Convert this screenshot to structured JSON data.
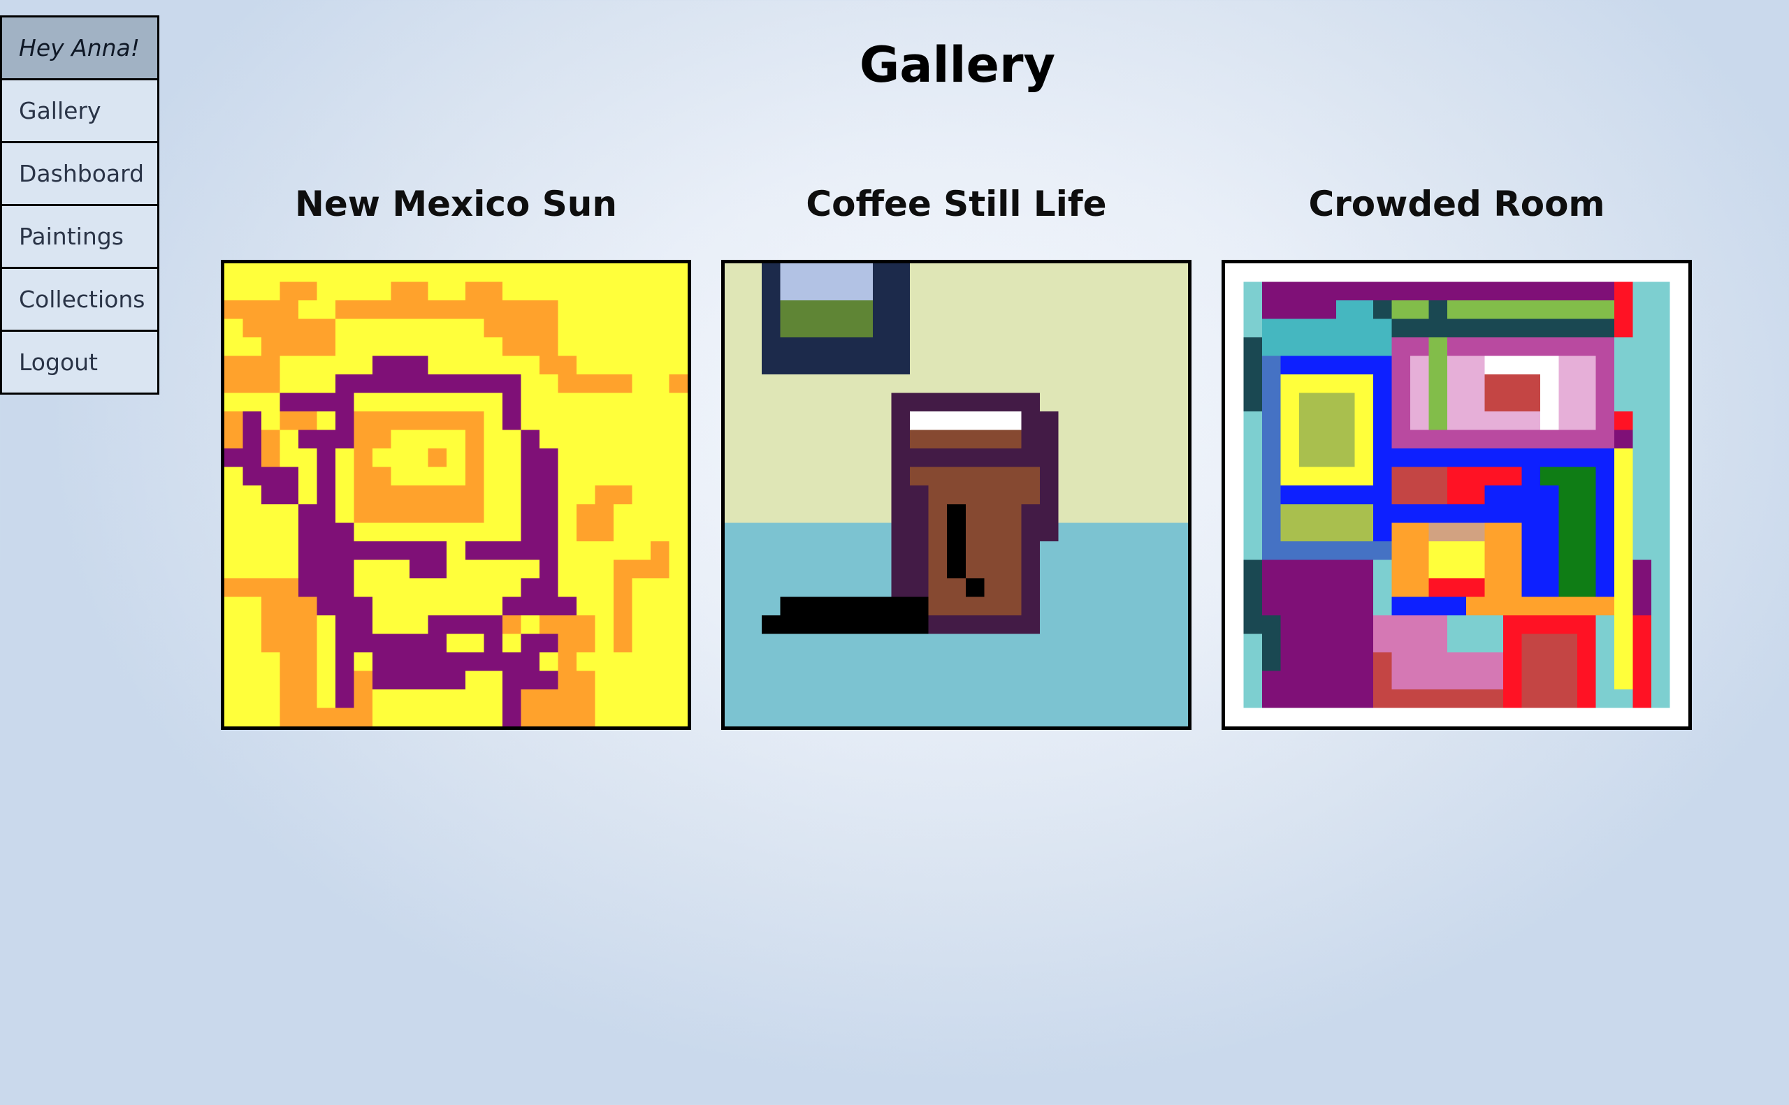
{
  "nav": {
    "greeting": "Hey Anna!",
    "items": [
      "Gallery",
      "Dashboard",
      "Paintings",
      "Collections",
      "Logout"
    ]
  },
  "page": {
    "title": "Gallery"
  },
  "paintings": [
    {
      "title": "New Mexico Sun"
    },
    {
      "title": "Coffee Still Life"
    },
    {
      "title": "Crowded Room"
    }
  ],
  "colors": {
    "sun_yellow": "#ffff3b",
    "sun_orange": "#ffa22c",
    "sun_purple": "#7f1077",
    "coffee_wall": "#dfe6b6",
    "coffee_table": "#7cc3d1",
    "coffee_frame": "#1c2a4b",
    "coffee_mug": "#431b46",
    "coffee_brown": "#864931",
    "room_magenta": "#7f1077",
    "room_blue": "#0d20ff",
    "room_red": "#ff1224",
    "room_yellow": "#ffff3b"
  }
}
